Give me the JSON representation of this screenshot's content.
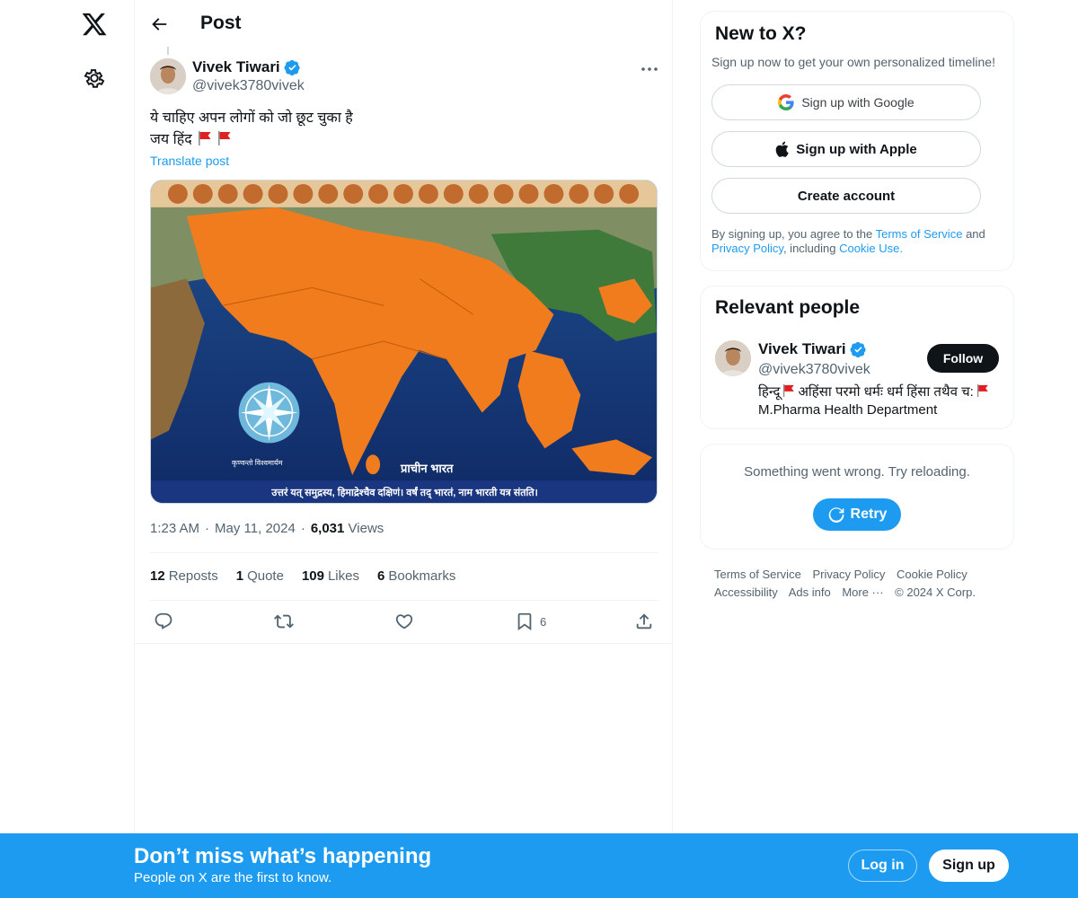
{
  "nav": {
    "logo": "x-logo-icon",
    "settings": "gear-icon"
  },
  "header": {
    "title": "Post"
  },
  "post": {
    "author_name": "Vivek Tiwari",
    "author_handle": "@vivek3780vivek",
    "text_line1": "ये चाहिए अपन लोगों को जो छूट चुका है",
    "text_line2": "जय हिंद",
    "translate_label": "Translate post",
    "media_caption_bottom": "उत्तरं यत् समुद्रस्य, हिमाद्रेश्चैव दक्षिणं। वर्षं तद् भारतं, नाम भारती यत्र संतति।",
    "media_caption_center": "प्राचीन भारत",
    "media_caption_compass": "कृण्वन्तो विश्वमार्यम",
    "time": "1:23 AM",
    "date": "May 11, 2024",
    "views_count": "6,031",
    "views_label": "Views",
    "reposts_count": "12",
    "reposts_label": "Reposts",
    "quotes_count": "1",
    "quotes_label": "Quote",
    "likes_count": "109",
    "likes_label": "Likes",
    "bookmarks_count": "6",
    "bookmarks_label": "Bookmarks",
    "bookmark_action_count": "6"
  },
  "signup_card": {
    "title": "New to X?",
    "subtitle": "Sign up now to get your own personalized timeline!",
    "google_label": "Sign up with Google",
    "apple_label": "Sign up with Apple",
    "create_label": "Create account",
    "legal_prefix": "By signing up, you agree to the",
    "terms_link": "Terms of Service",
    "legal_and": "and",
    "privacy_link": "Privacy Policy",
    "legal_including": ", including",
    "cookie_link": "Cookie Use."
  },
  "relevant": {
    "title": "Relevant people",
    "name": "Vivek Tiwari",
    "handle": "@vivek3780vivek",
    "follow_label": "Follow",
    "bio_part1": "हिन्दू",
    "bio_part2": "अहिंसा परमो धर्मः धर्म हिंसा तथैव च:",
    "bio_line2": "M.Pharma Health Department"
  },
  "error_card": {
    "message": "Something went wrong. Try reloading.",
    "retry_label": "Retry"
  },
  "footer": {
    "links": [
      "Terms of Service",
      "Privacy Policy",
      "Cookie Policy",
      "Accessibility",
      "Ads info",
      "More ···",
      "© 2024 X Corp."
    ]
  },
  "banner": {
    "title": "Don’t miss what’s happening",
    "subtitle": "People on X are the first to know.",
    "login_label": "Log in",
    "signup_label": "Sign up"
  },
  "colors": {
    "accent": "#1d9bf0",
    "text": "#0f1419",
    "muted": "#536471",
    "saffron": "#f07c1e"
  }
}
